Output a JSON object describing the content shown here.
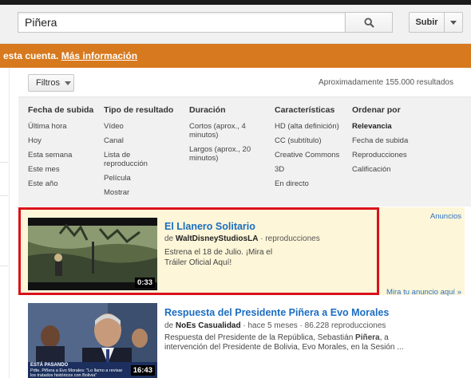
{
  "search": {
    "value": "Piñera"
  },
  "header": {
    "upload_label": "Subir"
  },
  "banner": {
    "prefix": "esta cuenta. ",
    "link": "Más información"
  },
  "filters": {
    "button_label": "Filtros",
    "result_count": "Aproximadamente 155.000 resultados",
    "columns": [
      {
        "title": "Fecha de subida",
        "items": [
          "Última hora",
          "Hoy",
          "Esta semana",
          "Este mes",
          "Este año"
        ]
      },
      {
        "title": "Tipo de resultado",
        "items": [
          "Vídeo",
          "Canal",
          "Lista de reproducción",
          "Película",
          "Mostrar"
        ]
      },
      {
        "title": "Duración",
        "items": [
          "Cortos (aprox., 4 minutos)",
          "Largos (aprox., 20 minutos)"
        ]
      },
      {
        "title": "Características",
        "items": [
          "HD (alta definición)",
          "CC (subtítulo)",
          "Creative Commons",
          "3D",
          "En directo"
        ]
      },
      {
        "title": "Ordenar por",
        "items": [
          "Relevancia",
          "Fecha de subida",
          "Reproducciones",
          "Calificación"
        ]
      }
    ]
  },
  "ad": {
    "label": "Anuncios",
    "title": "El Llanero Solitario",
    "by_prefix": "de ",
    "channel": "WaltDisneyStudiosLA",
    "meta": " · reproducciones",
    "description": "Estrena el 18 de Julio. ¡Mira el Tráiler Oficial Aquí!",
    "duration": "0:33",
    "more": "Mira tu anuncio aquí »"
  },
  "result": {
    "title": "Respuesta del Presidente Piñera a Evo Morales",
    "by_prefix": "de ",
    "channel": "NoEs Casualidad",
    "meta": " · hace 5 meses · 86.228 reproducciones",
    "description_start": "Respuesta del Presidente de la República, Sebastián ",
    "description_bold": "Piñera",
    "description_end": ", a intervención del Presidente de Bolivia, Evo Morales, en la Sesión ...",
    "duration": "16:43",
    "news_label": "ESTÁ PASANDO",
    "news_sub": "Pdte. Piñera a Evo Morales: \"Lo llamo a revisar los tratados históricos con Bolivia\""
  },
  "colors": {
    "banner": "#d7791e",
    "link": "#1b6dc1",
    "highlight": "#d9111b",
    "ad_bg": "#fdf6d8"
  }
}
